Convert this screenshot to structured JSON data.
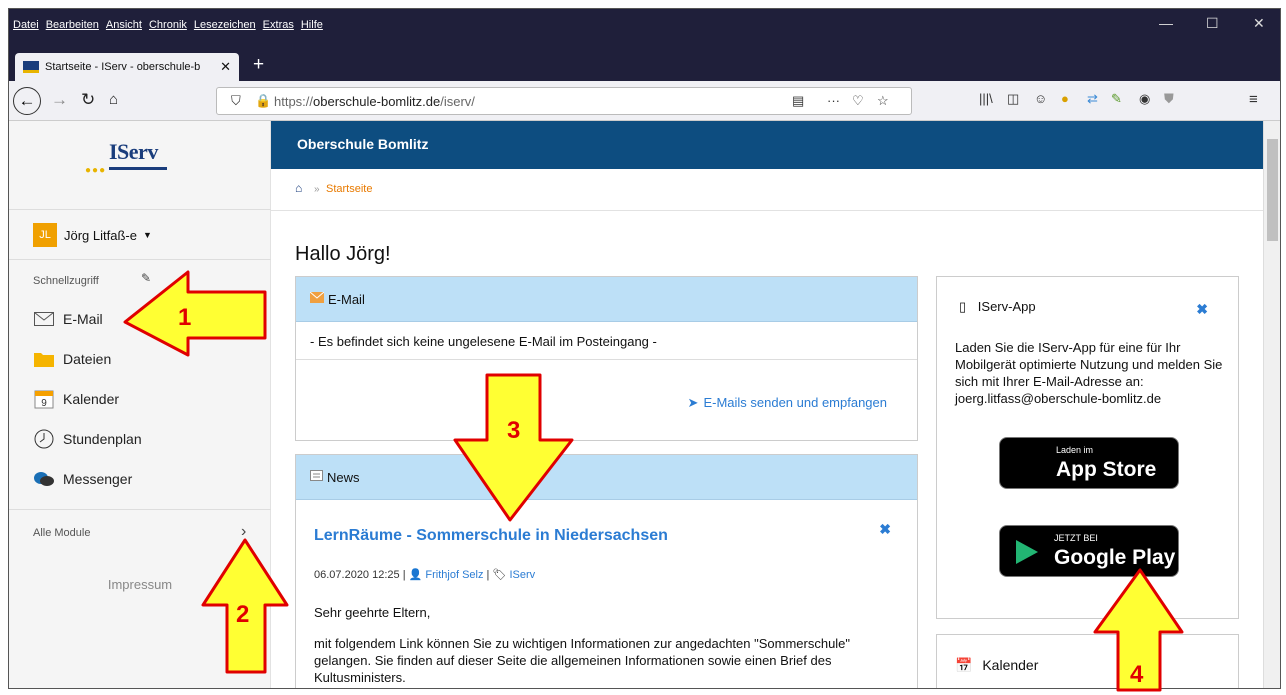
{
  "menubar": {
    "items": [
      "Datei",
      "Bearbeiten",
      "Ansicht",
      "Chronik",
      "Lesezeichen",
      "Extras",
      "Hilfe"
    ],
    "min": "—",
    "max": "☐",
    "close": "✕"
  },
  "tab": {
    "title": "Startseite - IServ - oberschule-b",
    "close": "✕",
    "new": "+"
  },
  "url": {
    "prefix": "https://",
    "host": "oberschule-bomlitz.de",
    "path": "/iserv/"
  },
  "sidebar": {
    "logo": "IServ",
    "user_initials": "JL",
    "user_name": "Jörg Litfaß-e",
    "quick_access": "Schnellzugriff",
    "items": [
      {
        "label": "E-Mail",
        "icon": "envelope-icon"
      },
      {
        "label": "Dateien",
        "icon": "folder-icon"
      },
      {
        "label": "Kalender",
        "icon": "calendar-icon"
      },
      {
        "label": "Stundenplan",
        "icon": "clock-icon"
      },
      {
        "label": "Messenger",
        "icon": "chat-icon"
      }
    ],
    "calendar_day": "9",
    "all_modules": "Alle Module",
    "impressum": "Impressum"
  },
  "header": {
    "title": "Oberschule Bomlitz"
  },
  "breadcrumb": {
    "current": "Startseite",
    "sep": "»"
  },
  "greeting": "Hallo Jörg!",
  "email_panel": {
    "title": "E-Mail",
    "empty": "- Es befindet sich keine ungelesene E-Mail im Posteingang -",
    "link": "E-Mails senden und empfangen"
  },
  "news_panel": {
    "title": "News",
    "headline": "LernRäume - Sommerschule in Niedersachsen",
    "date": "06.07.2020 12:25 |",
    "author": "Frithjof Selz",
    "meta_sep": "|",
    "tag": "IServ",
    "p1": "Sehr geehrte Eltern,",
    "p2": "mit folgendem Link können Sie zu wichtigen Informationen zur angedachten \"Sommerschule\"  gelangen. Sie finden auf dieser Seite die allgemeinen Informationen sowie einen Brief des Kultusministers."
  },
  "app_panel": {
    "title": "IServ-App",
    "text": "Laden Sie die IServ-App für eine für Ihr Mobilgerät optimierte Nutzung und melden Sie sich mit Ihrer E-Mail-Adresse an: joerg.litfass@oberschule-bomlitz.de",
    "appstore_small": "Laden im",
    "appstore_big": "App Store",
    "gplay_small": "JETZT BEI",
    "gplay_big": "Google Play"
  },
  "calendar_panel": {
    "title": "Kalender"
  },
  "annotations": [
    "1",
    "2",
    "3",
    "4"
  ],
  "colors": {
    "header": "#0d4d80",
    "panel_head": "#bde0f7",
    "link": "#2b7cd3",
    "arrow_fill": "#ffff33",
    "arrow_stroke": "#e00000"
  }
}
